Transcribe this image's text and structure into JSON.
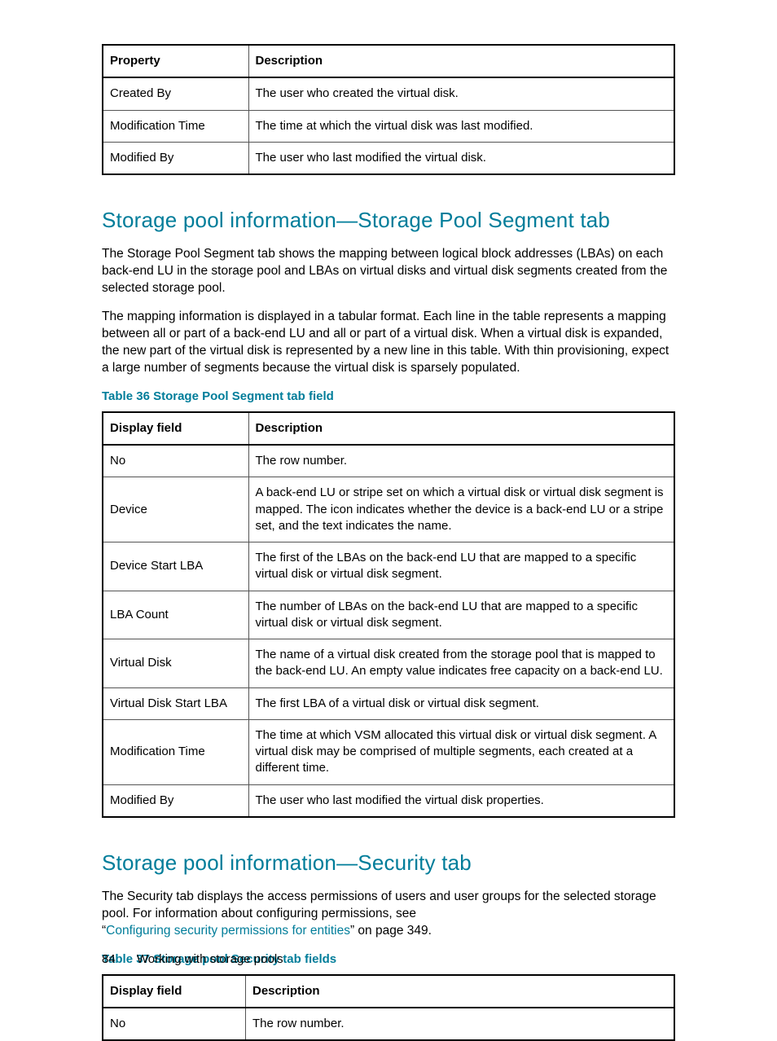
{
  "table1": {
    "head": {
      "c1": "Property",
      "c2": "Description"
    },
    "rows": [
      {
        "c1": "Created By",
        "c2": "The user who created the virtual disk."
      },
      {
        "c1": "Modification Time",
        "c2": "The time at which the virtual disk was last modified."
      },
      {
        "c1": "Modified By",
        "c2": "The user who last modified the virtual disk."
      }
    ]
  },
  "section1": {
    "heading": "Storage pool information—Storage Pool Segment tab",
    "p1": "The Storage Pool Segment tab shows the mapping between logical block addresses (LBAs) on each back-end LU in the storage pool and LBAs on virtual disks and virtual disk segments created from the selected storage pool.",
    "p2": "The mapping information is displayed in a tabular format. Each line in the table represents a mapping between all or part of a back-end LU and all or part of a virtual disk. When a virtual disk is expanded, the new part of the virtual disk is represented by a new line in this table. With thin provisioning, expect a large number of segments because the virtual disk is sparsely populated.",
    "caption": "Table 36 Storage Pool Segment tab field"
  },
  "table2": {
    "head": {
      "c1": "Display field",
      "c2": "Description"
    },
    "rows": [
      {
        "c1": "No",
        "c2": "The row number."
      },
      {
        "c1": "Device",
        "c2": "A back-end LU or stripe set on which a virtual disk or virtual disk segment is mapped. The icon indicates whether the device is a back-end LU or a stripe set, and the text indicates the name."
      },
      {
        "c1": "Device Start LBA",
        "c2": "The first of the LBAs on the back-end LU that are mapped to a specific virtual disk or virtual disk segment."
      },
      {
        "c1": "LBA Count",
        "c2": "The number of LBAs on the back-end LU that are mapped to a specific virtual disk or virtual disk segment."
      },
      {
        "c1": "Virtual Disk",
        "c2": "The name of a virtual disk created from the storage pool that is mapped to the back-end LU. An empty value indicates free capacity on a back-end LU."
      },
      {
        "c1": "Virtual Disk Start LBA",
        "c2": "The first LBA of a virtual disk or virtual disk segment."
      },
      {
        "c1": "Modification Time",
        "c2": "The time at which VSM allocated this virtual disk or virtual disk segment. A virtual disk may be comprised of multiple segments, each created at a different time."
      },
      {
        "c1": "Modified By",
        "c2": "The user who last modified the virtual disk properties."
      }
    ]
  },
  "section2": {
    "heading": "Storage pool information—Security tab",
    "p1a": "The Security tab displays the access permissions of users and user groups for the selected storage pool. For information about configuring permissions, see",
    "p1b": "“",
    "link": "Configuring security permissions for entities",
    "p1c": "” on page 349.",
    "caption": "Table 37 Storage pool Security tab fields"
  },
  "table3": {
    "head": {
      "c1": "Display field",
      "c2": "Description"
    },
    "rows": [
      {
        "c1": "No",
        "c2": "The row number."
      }
    ]
  },
  "footer": {
    "page": "84",
    "title": "Working with storage pools"
  }
}
